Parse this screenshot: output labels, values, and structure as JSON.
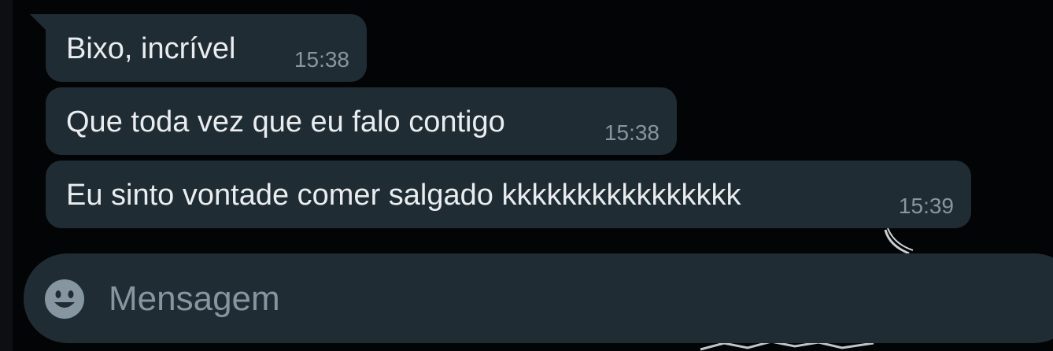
{
  "messages": [
    {
      "text": "Bixo, incrível",
      "time": "15:38"
    },
    {
      "text": "Que toda vez que eu falo contigo",
      "time": "15:38"
    },
    {
      "text": "Eu sinto vontade comer salgado kkkkkkkkkkkkkkkk",
      "time": "15:39"
    }
  ],
  "composer": {
    "placeholder": "Mensagem",
    "emoji_icon": "smiley-icon"
  },
  "colors": {
    "background": "#030405",
    "bubble": "#202c33",
    "text": "#e9edef",
    "muted": "#8696a0"
  }
}
